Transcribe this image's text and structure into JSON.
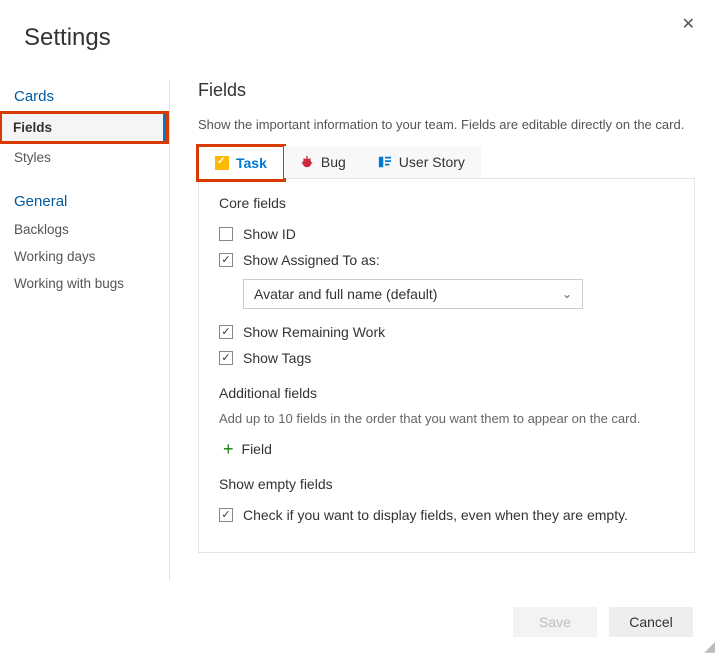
{
  "header": {
    "title": "Settings"
  },
  "sidebar": {
    "section1_title": "Cards",
    "items1": [
      "Fields",
      "Styles"
    ],
    "section2_title": "General",
    "items2": [
      "Backlogs",
      "Working days",
      "Working with bugs"
    ]
  },
  "main": {
    "title": "Fields",
    "description": "Show the important information to your team. Fields are editable directly on the card.",
    "tabs": [
      {
        "label": "Task",
        "icon": "task-icon"
      },
      {
        "label": "Bug",
        "icon": "bug-icon"
      },
      {
        "label": "User Story",
        "icon": "user-story-icon"
      }
    ],
    "core_label": "Core fields",
    "show_id_label": "Show ID",
    "show_assigned_label": "Show Assigned To as:",
    "assigned_select_value": "Avatar and full name (default)",
    "show_remaining_label": "Show Remaining Work",
    "show_tags_label": "Show Tags",
    "additional_label": "Additional fields",
    "additional_hint": "Add up to 10 fields in the order that you want them to appear on the card.",
    "add_field_label": "Field",
    "empty_label": "Show empty fields",
    "empty_check_label": "Check if you want to display fields, even when they are empty.",
    "checks": {
      "show_id": false,
      "show_assigned": true,
      "show_remaining": true,
      "show_tags": true,
      "show_empty": true
    }
  },
  "footer": {
    "save": "Save",
    "cancel": "Cancel"
  }
}
